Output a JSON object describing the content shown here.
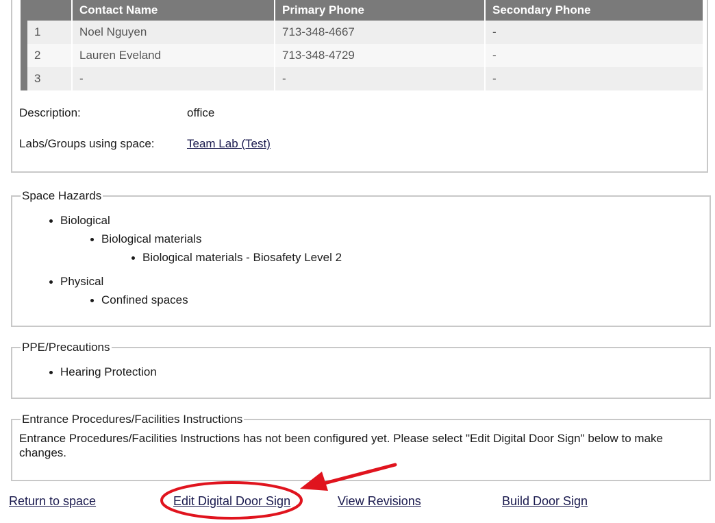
{
  "contacts": {
    "headers": [
      "",
      "Contact Name",
      "Primary Phone",
      "Secondary Phone"
    ],
    "rows": [
      {
        "index": "1",
        "name": "Noel Nguyen",
        "primary": "713-348-4667",
        "secondary": "-"
      },
      {
        "index": "2",
        "name": "Lauren Eveland",
        "primary": "713-348-4729",
        "secondary": "-"
      },
      {
        "index": "3",
        "name": "-",
        "primary": "-",
        "secondary": "-"
      }
    ]
  },
  "details": {
    "description_label": "Description:",
    "description_value": "office",
    "labs_label": "Labs/Groups using space:",
    "labs_value": "Team Lab (Test)"
  },
  "hazards": {
    "legend": "Space Hazards",
    "items": [
      {
        "label": "Biological",
        "sub": "Biological materials",
        "subsub": "Biological materials - Biosafety Level 2"
      },
      {
        "label": "Physical",
        "sub": "Confined spaces"
      }
    ]
  },
  "ppe": {
    "legend": "PPE/Precautions",
    "items": [
      "Hearing Protection"
    ]
  },
  "entrance": {
    "legend": "Entrance Procedures/Facilities Instructions",
    "text": "Entrance Procedures/Facilities Instructions has not been configured yet. Please select \"Edit Digital Door Sign\" below to make changes."
  },
  "links": {
    "return": "Return to space",
    "edit": "Edit Digital Door Sign",
    "revisions": "View Revisions",
    "build": "Build Door Sign"
  },
  "annotation": {
    "color": "#e0141e"
  }
}
